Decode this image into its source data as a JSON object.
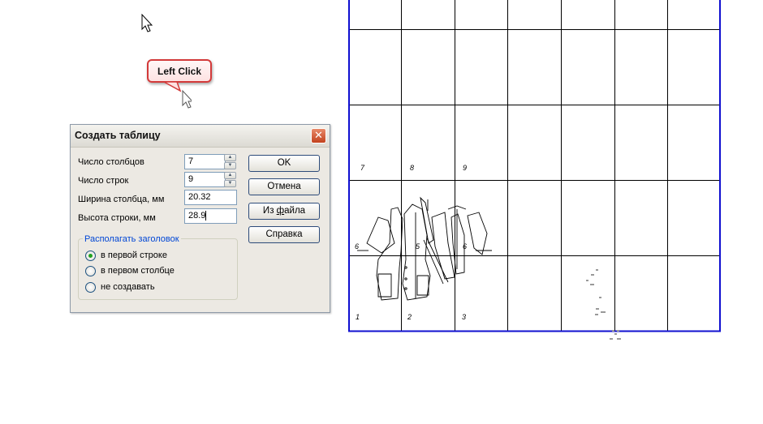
{
  "tooltip": {
    "text": "Left Click"
  },
  "dialog": {
    "title": "Создать таблицу",
    "close_glyph": "✕",
    "fields": [
      {
        "label": "Число столбцов",
        "value": "7"
      },
      {
        "label": "Число строк",
        "value": "9"
      },
      {
        "label": "Ширина столбца, мм",
        "value": "20.32"
      },
      {
        "label": "Высота строки, мм",
        "value": "28.9"
      }
    ],
    "buttons": {
      "ok": "OK",
      "cancel": "Отмена",
      "from_file_pre": "Из ",
      "from_file_key": "ф",
      "from_file_post": "айла",
      "help": "Справка"
    },
    "header_group": {
      "legend": "Располагать заголовок",
      "options": [
        {
          "label": "в первой строке",
          "checked": true
        },
        {
          "label": "в первом столбце",
          "checked": false
        },
        {
          "label": "не создавать",
          "checked": false
        }
      ]
    }
  },
  "table": {
    "border_color": "#0000cc",
    "cell_numbers": [
      "7",
      "8",
      "9",
      "6",
      "5",
      "6",
      "1",
      "2",
      "3"
    ]
  }
}
